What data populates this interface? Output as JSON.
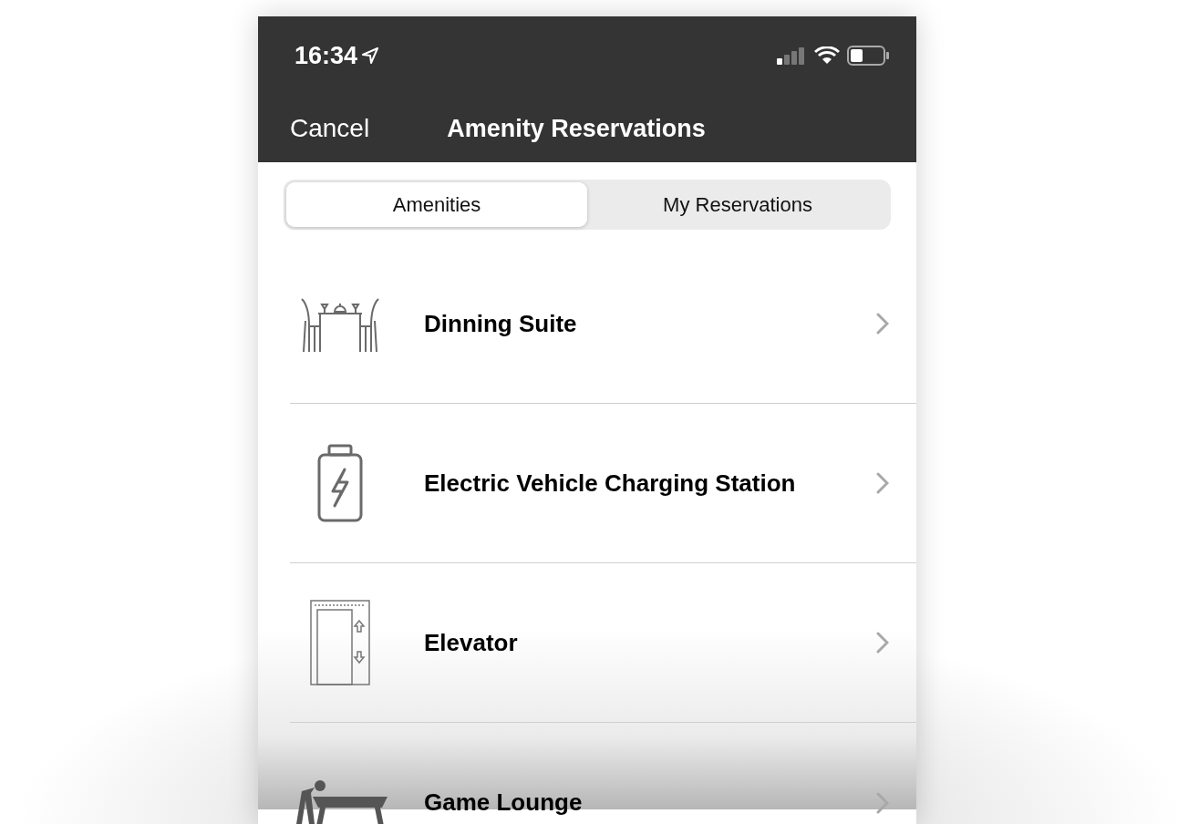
{
  "status_bar": {
    "time": "16:34"
  },
  "nav_bar": {
    "cancel": "Cancel",
    "title": "Amenity Reservations"
  },
  "tabs": [
    {
      "label": "Amenities",
      "selected": true
    },
    {
      "label": "My Reservations",
      "selected": false
    }
  ],
  "amenities": [
    {
      "name": "Dinning Suite"
    },
    {
      "name": "Electric Vehicle Charging Station"
    },
    {
      "name": "Elevator"
    },
    {
      "name": "Game Lounge"
    }
  ]
}
